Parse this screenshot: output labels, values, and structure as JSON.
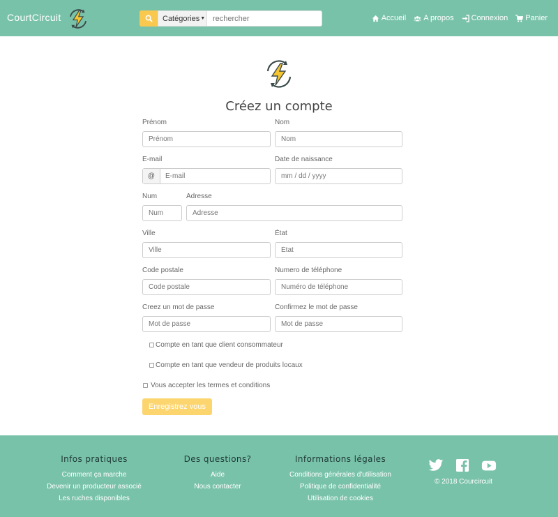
{
  "header": {
    "brand": "CourtCircuit",
    "categories_label": "Catégories",
    "search_placeholder": "rechercher",
    "nav": [
      {
        "label": "Accueil",
        "icon": "home-icon"
      },
      {
        "label": "A propos",
        "icon": "users-icon"
      },
      {
        "label": "Connexion",
        "icon": "sign-in-icon"
      },
      {
        "label": "Panier",
        "icon": "cart-icon"
      }
    ]
  },
  "form": {
    "title": "Créez un compte",
    "prenom": {
      "label": "Prénom",
      "placeholder": "Prénom"
    },
    "nom": {
      "label": "Nom",
      "placeholder": "Nom"
    },
    "email": {
      "label": "E-mail",
      "addon": "@",
      "placeholder": "E-mail"
    },
    "birth": {
      "label": "Date de naissance",
      "placeholder": "mm / dd / yyyy"
    },
    "num": {
      "label": "Num",
      "placeholder": "Num"
    },
    "adresse": {
      "label": "Adresse",
      "placeholder": "Adresse"
    },
    "ville": {
      "label": "Ville",
      "placeholder": "Ville"
    },
    "etat": {
      "label": "État",
      "placeholder": "État"
    },
    "code_postal": {
      "label": "Code postale",
      "placeholder": "Code postale"
    },
    "phone": {
      "label": "Numero de téléphone",
      "placeholder": "Numéro de téléphone"
    },
    "password": {
      "label": "Creez un mot de passe",
      "placeholder": "Mot de passe"
    },
    "password_confirm": {
      "label": "Confirmez le mot de passe",
      "placeholder": "Mot de passe"
    },
    "check_client": "Compte en tant que client consommateur",
    "check_vendeur": "Compte en tant que vendeur de produits locaux",
    "check_terms": "Vous accepter les termes et conditions",
    "submit_label": "Enregistrez vous"
  },
  "footer": {
    "col1": {
      "title": "Infos pratiques",
      "links": [
        "Comment ça marche",
        "Devenir un producteur associé",
        "Les ruches disponibles"
      ]
    },
    "col2": {
      "title": "Des questions?",
      "links": [
        "Aide",
        "Nous contacter"
      ]
    },
    "col3": {
      "title": "Informations légales",
      "links": [
        "Conditions générales d'utilisation",
        "Politique de confidentialité",
        "Utilisation de cookies"
      ]
    },
    "social": [
      "twitter-icon",
      "facebook-icon",
      "youtube-icon"
    ],
    "copyright": "© 2018 Courcircuit"
  },
  "colors": {
    "primary": "#79c2aa",
    "accent": "#f9c84f",
    "submit": "#fcd56e"
  }
}
